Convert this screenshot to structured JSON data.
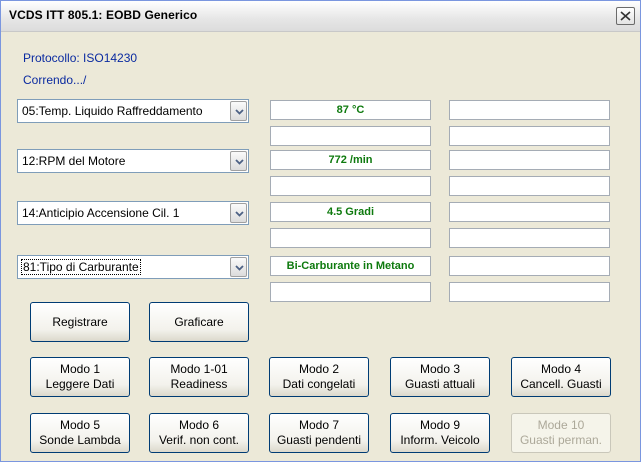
{
  "window": {
    "title": "VCDS ITT 805.1:  EOBD Generico"
  },
  "status": {
    "protocol": "Protocollo: ISO14230",
    "running": "Correndo.../"
  },
  "rows": [
    {
      "select": "05:Temp. Liquido Raffreddamento",
      "value1": "87 °C",
      "value2": "",
      "value3": "",
      "value4": ""
    },
    {
      "select": "12:RPM del Motore",
      "value1": "772 /min",
      "value2": "",
      "value3": "",
      "value4": ""
    },
    {
      "select": "14:Anticipio Accensione Cil. 1",
      "value1": "4.5 Gradi",
      "value2": "",
      "value3": "",
      "value4": ""
    },
    {
      "select": "81:Tipo di Carburante",
      "value1": "Bi-Carburante in Metano",
      "value2": "",
      "value3": "",
      "value4": ""
    }
  ],
  "buttons": {
    "record": "Registrare",
    "graph": "Graficare",
    "mode1": {
      "l1": "Modo 1",
      "l2": "Leggere Dati"
    },
    "mode101": {
      "l1": "Modo 1-01",
      "l2": "Readiness"
    },
    "mode2": {
      "l1": "Modo 2",
      "l2": "Dati congelati"
    },
    "mode3": {
      "l1": "Modo 3",
      "l2": "Guasti attuali"
    },
    "mode4": {
      "l1": "Modo 4",
      "l2": "Cancell. Guasti"
    },
    "mode5": {
      "l1": "Modo 5",
      "l2": "Sonde Lambda"
    },
    "mode6": {
      "l1": "Modo 6",
      "l2": "Verif. non cont."
    },
    "mode7": {
      "l1": "Modo 7",
      "l2": "Guasti pendenti"
    },
    "mode9": {
      "l1": "Modo 9",
      "l2": "Inform. Veicolo"
    },
    "mode10": {
      "l1": "Mode 10",
      "l2": "Guasti perman."
    }
  },
  "icons": {
    "close": "close-icon",
    "dropdown": "chevron-down-icon"
  },
  "colors": {
    "value_text": "#0e7a0e",
    "status_text": "#0a2aa0",
    "button_border": "#003c74"
  }
}
